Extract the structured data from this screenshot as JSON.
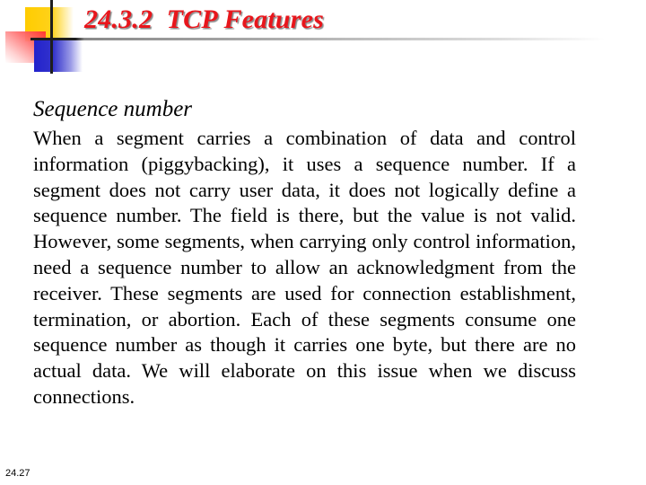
{
  "slide": {
    "title": "24.3.2  TCP Features",
    "subheading": "Sequence number",
    "body": "When a segment carries a combination of data and control information (piggybacking), it uses a sequence number. If a segment does not carry user data, it does not logically define a sequence number. The field is there, but the value is not valid. However, some segments, when carrying only control information, need a sequence number to allow an acknowledgment from the receiver. These segments are used for connection establishment, termination, or abortion. Each of these segments consume one sequence number as though it carries one byte, but there are no actual data. We will elaborate on this issue when we discuss connections.",
    "slide_number": "24.27"
  },
  "logo": {
    "icon": "color-squares-logo-icon",
    "colors": {
      "yellow": "#ffcc00",
      "red": "#ff3030",
      "blue": "#2222cc",
      "lines": "#1e1e1e"
    }
  },
  "theme": {
    "title_color": "#e8161c",
    "text_color": "#000000",
    "background": "#ffffff"
  }
}
